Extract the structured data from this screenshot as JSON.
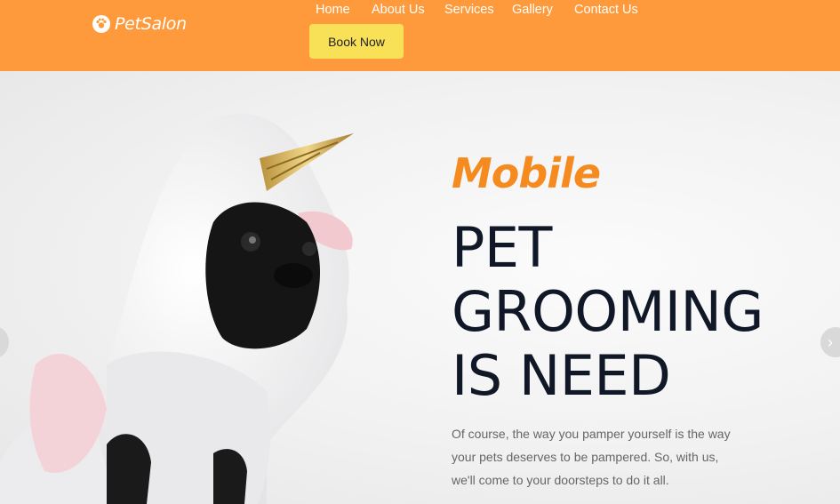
{
  "header": {
    "brand": "PetSalon",
    "brand_icon": "paw-icon",
    "background_color": "#ff9a3c",
    "nav": {
      "home": "Home",
      "about": "About Us",
      "services": "Services",
      "gallery": "Gallery",
      "contact": "Contact Us"
    },
    "cta_label": "Book Now",
    "cta_color": "#f8e157"
  },
  "hero": {
    "eyebrow": "Mobile",
    "eyebrow_color": "#f58a1f",
    "headline_lines": [
      "PET",
      "GROOMING",
      "IS NEED"
    ],
    "description": "Of course, the way you pamper yourself is the way your pets deserves to be pampered. So, with us, we'll come to your doorsteps to do it all.",
    "image": "french bulldog in unicorn costume",
    "prev_icon": "chevron-left-icon",
    "next_icon": "chevron-right-icon",
    "next_glyph": "›"
  }
}
